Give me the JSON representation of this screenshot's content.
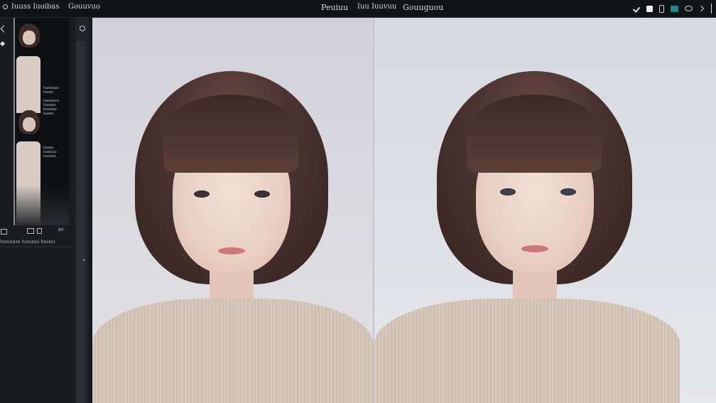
{
  "topbar": {
    "left_title": "Iuuss Iuoibas",
    "left_menu": "Gouuvuo",
    "center_items": [
      "Peuiuu",
      "Iuu Iuuvuu",
      "Gouuguou"
    ]
  },
  "sidebar": {
    "thumb_text_1": "Iuuiuuuu\nIuuuu\n\nIuuuuiuu\nIuuuuu\nIuuuuiu\nIuuuu",
    "thumb_text_2": "Iuuuu\nIuuiuuu\nIuuuuu",
    "footer_label": "80",
    "caption": "Iuuuuuu Iuuuuu Iuuuu"
  },
  "icons": {
    "topbar_right": [
      "check-icon",
      "square-icon",
      "phone-icon",
      "teal-tile-icon",
      "eye-icon",
      "chevron-right-icon",
      "divider"
    ]
  },
  "colors": {
    "background": "#141518",
    "sidebar": "#1a1c20",
    "accent_teal": "#1f8a8e"
  }
}
